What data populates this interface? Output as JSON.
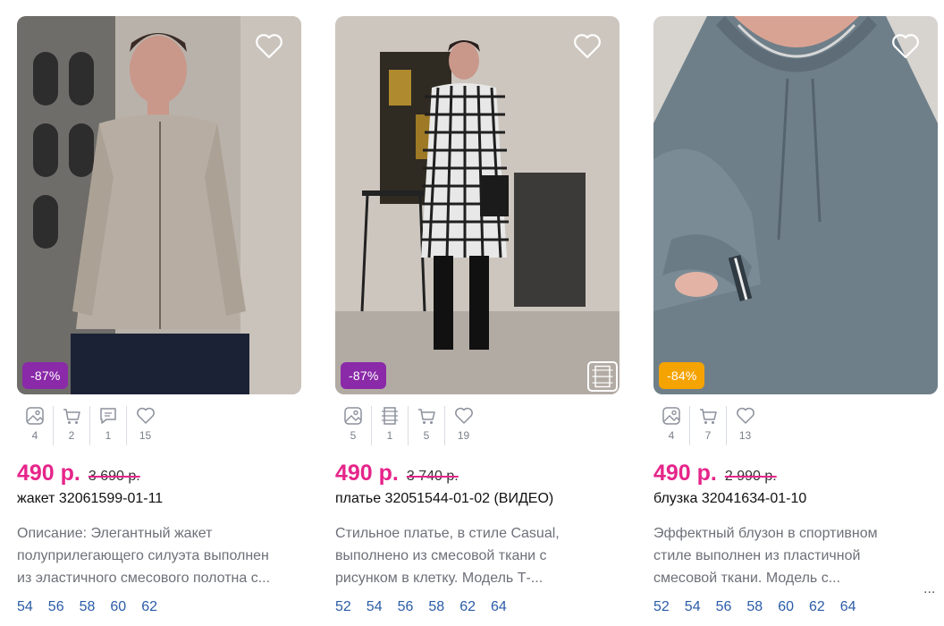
{
  "products": [
    {
      "badge": "-87%",
      "badge_color": "#8a2aa8",
      "stats": [
        "4",
        "2",
        "1",
        "15"
      ],
      "price": "490 р.",
      "old_price": "3 690 р.",
      "title": "жакет 32061599-01-11",
      "desc_lines": [
        "Описание: Элегантный жакет",
        "полуприлегающего силуэта выполнен",
        "из эластичного смесового полотна с..."
      ],
      "sizes": [
        "54",
        "56",
        "58",
        "60",
        "62"
      ]
    },
    {
      "badge": "-87%",
      "badge_color": "#8a2aa8",
      "stats": [
        "5",
        "1",
        "5",
        "19"
      ],
      "price": "490 р.",
      "old_price": "3 740 р.",
      "title": "платье 32051544-01-02 (ВИДЕО)",
      "desc_lines": [
        "Стильное платье, в стиле Casual,",
        "выполнено из смесовой ткани с",
        "рисунком в клетку. Модель Т-..."
      ],
      "sizes": [
        "52",
        "54",
        "56",
        "58",
        "62",
        "64"
      ]
    },
    {
      "badge": "-84%",
      "badge_color": "#f5a300",
      "stats": [
        "4",
        "7",
        "13"
      ],
      "price": "490 р.",
      "old_price": "2 990 р.",
      "title": "блузка 32041634-01-10",
      "desc_lines": [
        "Эффектный блузон в спортивном",
        "стиле выполнен из пластичной",
        "смесовой ткани. Модель с..."
      ],
      "sizes": [
        "52",
        "54",
        "56",
        "58",
        "60",
        "62",
        "64"
      ]
    }
  ],
  "more_label": "..."
}
